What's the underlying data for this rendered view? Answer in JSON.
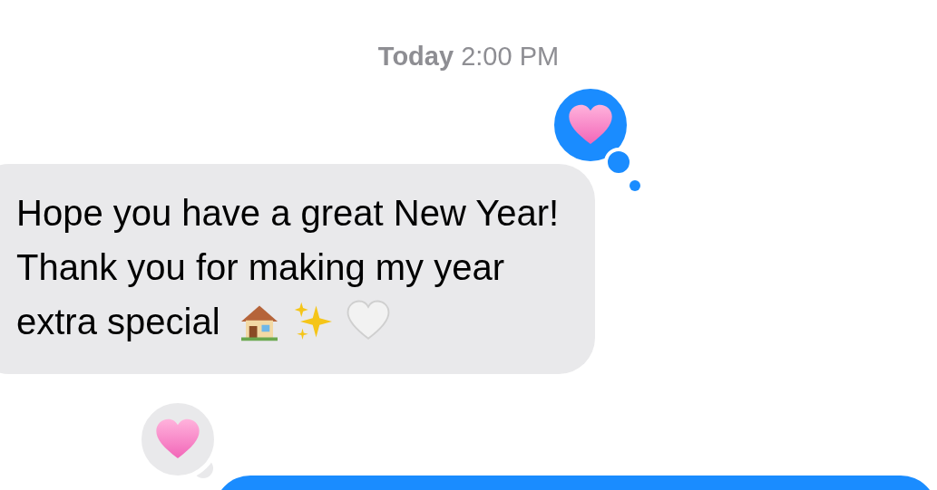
{
  "timestamp": {
    "day": "Today",
    "time": "2:00 PM"
  },
  "messages": [
    {
      "kind": "received",
      "lines": [
        "Hope you have a great New Year!",
        "Thank you for making my year",
        "extra special"
      ],
      "emoji": [
        {
          "kind": "house"
        },
        {
          "kind": "sparkles"
        },
        {
          "kind": "white-heart"
        }
      ],
      "reaction": {
        "kind": "heart"
      }
    },
    {
      "kind": "sent",
      "reaction": {
        "kind": "heart"
      }
    }
  ]
}
